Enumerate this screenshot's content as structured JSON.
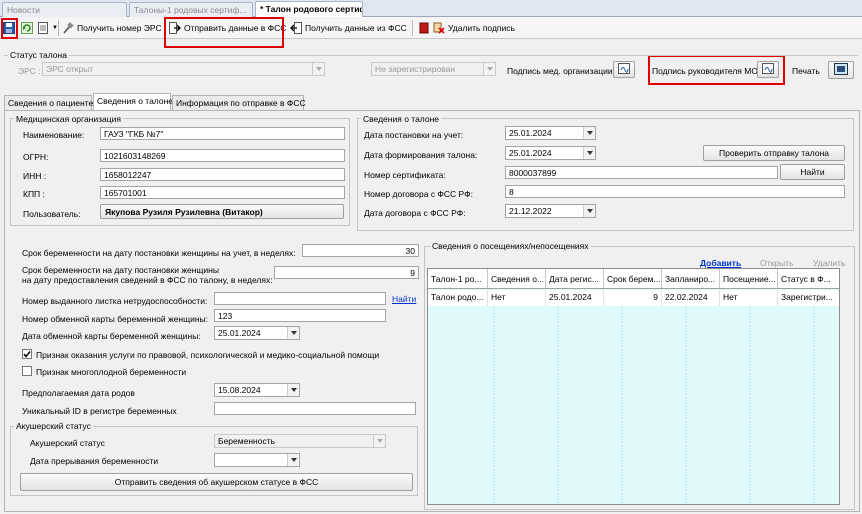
{
  "tabs": [
    {
      "label": "Новости"
    },
    {
      "label": "Талоны-1 родовых сертиф..."
    },
    {
      "label": "* Талон родового сертиф..."
    }
  ],
  "toolbar": {
    "get_ers": "Получить номер ЭРС",
    "send_fss": "Отправить данные в ФСС",
    "get_fss": "Получить данные из ФСС",
    "delete_sign": "Удалить подпись"
  },
  "status": {
    "group_title": "Статус талона",
    "ers_label": "ЭРС :",
    "ers_value": "ЭРС открыт",
    "reg_value": "Не зарегистрирован",
    "sign_med_org": "Подпись мед. организации",
    "sign_head": "Подпись руководителя МО",
    "print": "Печать"
  },
  "inner_tabs": [
    {
      "label": "Сведения о пациенте"
    },
    {
      "label": "Сведения о талоне"
    },
    {
      "label": "Информация по отправке в ФСС"
    }
  ],
  "med_org": {
    "title": "Медицинская организация",
    "name_label": "Наименование:",
    "name": "ГАУЗ \"ГКБ №7\"",
    "ogrn_label": "ОГРН:",
    "ogrn": "1021603148269",
    "inn_label": "ИНН :",
    "inn": "1658012247",
    "kpp_label": "КПП :",
    "kpp": "165701001",
    "user_label": "Пользователь:",
    "user": "Якупова Рузиля Рузилевна (Витакор)"
  },
  "talon": {
    "title": "Сведения о талоне",
    "date_reg_label": "Дата постановки на учет:",
    "date_reg": "25.01.2024",
    "date_form_label": "Дата формирования талона:",
    "date_form": "25.01.2024",
    "check_btn": "Проверить отправку талона",
    "cert_label": "Номер сертификата:",
    "cert": "8000037899",
    "find_btn": "Найти",
    "contract_label": "Номер договора с ФСС РФ:",
    "contract": "8",
    "contract_date_label": "Дата договора с ФСС РФ:",
    "contract_date": "21.12.2022"
  },
  "preg": {
    "term_reg_label": "Срок беременности на дату постановки женщины на учет, в неделях:",
    "term_reg": "30",
    "term_fss_label1": "Срок беременности на дату постановки женщины",
    "term_fss_label2": "на дату предоставления сведений в ФСС по талону, в неделях:",
    "term_fss": "9",
    "sick_list_label": "Номер выданного листка нетрудоспособности:",
    "sick_list": "",
    "find_link": "Найти",
    "exch_card_label": "Номер обменной карты беременной женщины:",
    "exch_card": "123",
    "exch_date_label": "Дата обменной карты беременной женщины:",
    "exch_date": "25.01.2024",
    "chk_help_label": "Признак оказания услуги по правовой, психологической и медико-социальной помощи",
    "chk_multi_label": "Признак многоплодной беременности",
    "birth_date_label": "Предполагаемая дата родов",
    "birth_date": "15.08.2024",
    "uid_label": "Уникальный ID в регистре беременных",
    "uid": ""
  },
  "obst": {
    "title": "Акушерский статус",
    "status_label": "Акушерский статус",
    "status": "Беременность",
    "term_date_label": "Дата прерывания беременности",
    "term_date": "",
    "send_btn": "Отправить сведения  об акушерском статусе в ФСС"
  },
  "visits": {
    "title": "Сведения о посещениях/непосещениях",
    "add": "Добавить",
    "open": "Открыть",
    "delete": "Удалить",
    "columns": [
      "Талон-1 ро...",
      "Сведения о...",
      "Дата регис...",
      "Срок берем...",
      "Запланиро...",
      "Посещение...",
      "Статус в Ф..."
    ],
    "rows": [
      [
        "Талон родо...",
        "Нет",
        "25.01.2024",
        "9",
        "22.02.2024",
        "Нет",
        "Зарегистри..."
      ]
    ]
  },
  "colors": {
    "highlight": "#e00000",
    "grid_bg": "#e0f9fb",
    "link": "#0033cc"
  }
}
